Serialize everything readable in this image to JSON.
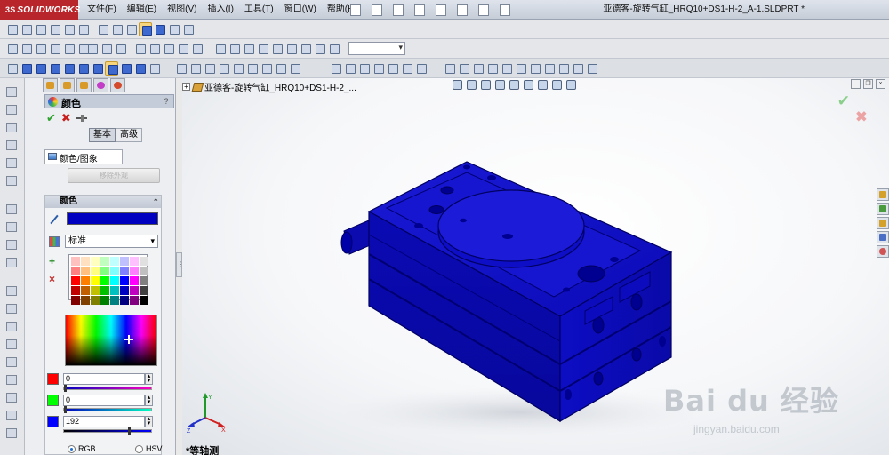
{
  "app": {
    "brand": "SOLIDWORKS",
    "brand_prefix": "3S",
    "document_title": "亚德客-旋转气缸_HRQ10+DS1-H-2_A-1.SLDPRT *"
  },
  "menu": {
    "items": [
      {
        "label": "文件(F)",
        "name": "menu-file"
      },
      {
        "label": "编辑(E)",
        "name": "menu-edit"
      },
      {
        "label": "视图(V)",
        "name": "menu-view"
      },
      {
        "label": "插入(I)",
        "name": "menu-insert"
      },
      {
        "label": "工具(T)",
        "name": "menu-tools"
      },
      {
        "label": "窗口(W)",
        "name": "menu-window"
      },
      {
        "label": "帮助(H)",
        "name": "menu-help"
      }
    ]
  },
  "property_manager": {
    "title": "颜色",
    "help": "?",
    "mode_tabs": [
      "基本",
      "高级"
    ],
    "active_mode": "基本",
    "subtab": "颜色/图象",
    "faded_button": "移除外观",
    "section_title": "颜色",
    "current_color": "#0000c0",
    "palette_select": "标准",
    "channels": [
      {
        "name": "red",
        "value": "0",
        "swatch": "#ff0000",
        "fraction": 0.0
      },
      {
        "name": "green",
        "value": "0",
        "swatch": "#00ff00",
        "fraction": 0.0
      },
      {
        "name": "blue",
        "value": "192",
        "swatch": "#0000ff",
        "fraction": 0.75
      }
    ],
    "color_modes": [
      "RGB",
      "HSV"
    ],
    "active_color_mode": "RGB",
    "swatches": [
      "#ffc0c0",
      "#ffe0c0",
      "#ffffc0",
      "#c0ffc0",
      "#c0ffff",
      "#c0c0ff",
      "#ffc0ff",
      "#e0e0e0",
      "#ff8080",
      "#ffc080",
      "#ffff80",
      "#80ff80",
      "#80ffff",
      "#8080ff",
      "#ff80ff",
      "#c0c0c0",
      "#ff0000",
      "#ff8000",
      "#ffff00",
      "#00ff00",
      "#00ffff",
      "#0000ff",
      "#ff00ff",
      "#808080",
      "#c00000",
      "#c06000",
      "#c0c000",
      "#00c000",
      "#00c0c0",
      "#0000c0",
      "#c000c0",
      "#404040",
      "#800000",
      "#804000",
      "#808000",
      "#008000",
      "#008080",
      "#000080",
      "#800080",
      "#000000"
    ],
    "selected_swatch_index": 29
  },
  "graphics": {
    "tree_root": "亚德客-旋转气缸_HRQ10+DS1-H-2_...",
    "view_name": "*等轴测",
    "triad_labels": {
      "x": "X",
      "y": "Y",
      "z": "Z"
    },
    "model_color": "#0000c8"
  },
  "watermark": {
    "main": "Bai du 经验",
    "url": "jingyan.baidu.com"
  }
}
